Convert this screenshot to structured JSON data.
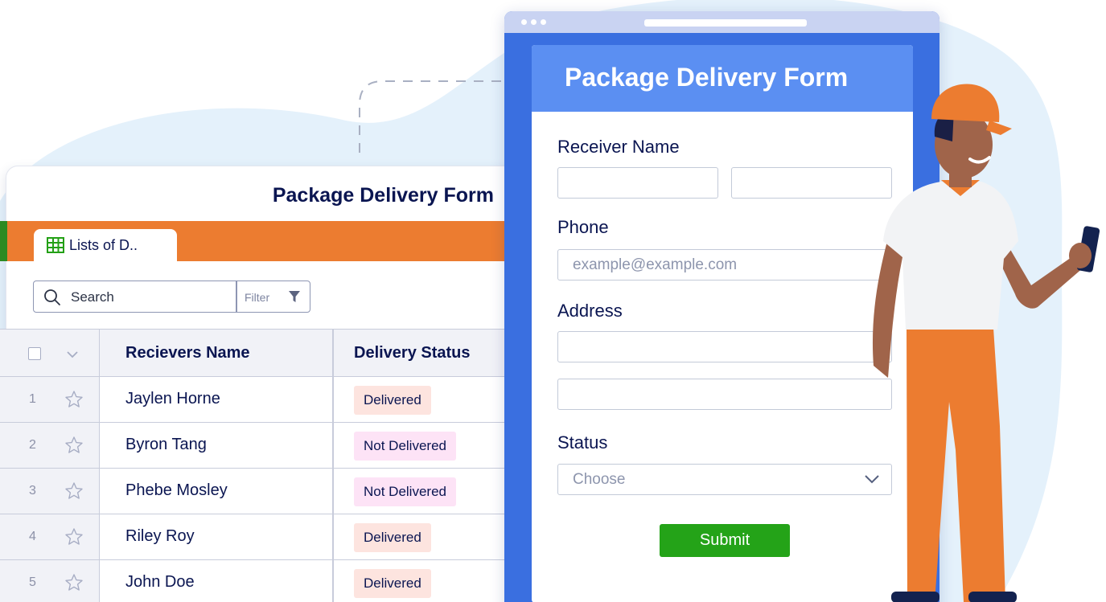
{
  "colors": {
    "form_window": "#3a6fe0",
    "form_header": "#5b8ff2",
    "table_accent_bar": "#ec7c30",
    "submit_button": "#24a318",
    "delivered_badge": "#fde4df",
    "not_delivered_badge": "#fde3f6",
    "heading_text": "#0a1551"
  },
  "table": {
    "title": "Package Delivery Form",
    "tab_label": "Lists of D..",
    "tab_icon": "table-grid-icon",
    "search_label": "Search",
    "filter_label": "Filter",
    "columns": [
      "Recievers Name",
      "Delivery Status"
    ],
    "rows": [
      {
        "num": "1",
        "name": "Jaylen Horne",
        "status": "Delivered",
        "status_kind": "delivered"
      },
      {
        "num": "2",
        "name": "Byron Tang",
        "status": "Not Delivered",
        "status_kind": "not-delivered"
      },
      {
        "num": "3",
        "name": "Phebe Mosley",
        "status": "Not Delivered",
        "status_kind": "not-delivered"
      },
      {
        "num": "4",
        "name": "Riley Roy",
        "status": "Delivered",
        "status_kind": "delivered"
      },
      {
        "num": "5",
        "name": "John Doe",
        "status": "Delivered",
        "status_kind": "delivered"
      }
    ]
  },
  "form": {
    "title": "Package Delivery Form",
    "receiver_label": "Receiver Name",
    "phone_label": "Phone",
    "phone_placeholder": "example@example.com",
    "address_label": "Address",
    "status_label": "Status",
    "status_value": "Choose",
    "submit_label": "Submit"
  }
}
